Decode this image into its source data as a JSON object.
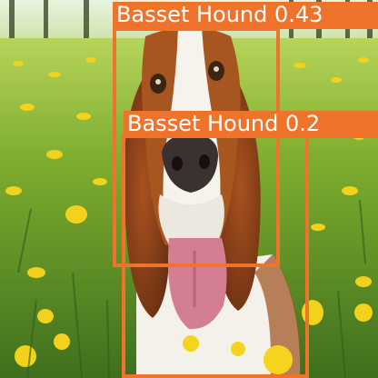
{
  "detections": [
    {
      "label": "Basset Hound",
      "score": "0.43",
      "color": "#f0732b"
    },
    {
      "label": "Basset Hound",
      "score": "0.2",
      "color": "#f0732b"
    }
  ]
}
